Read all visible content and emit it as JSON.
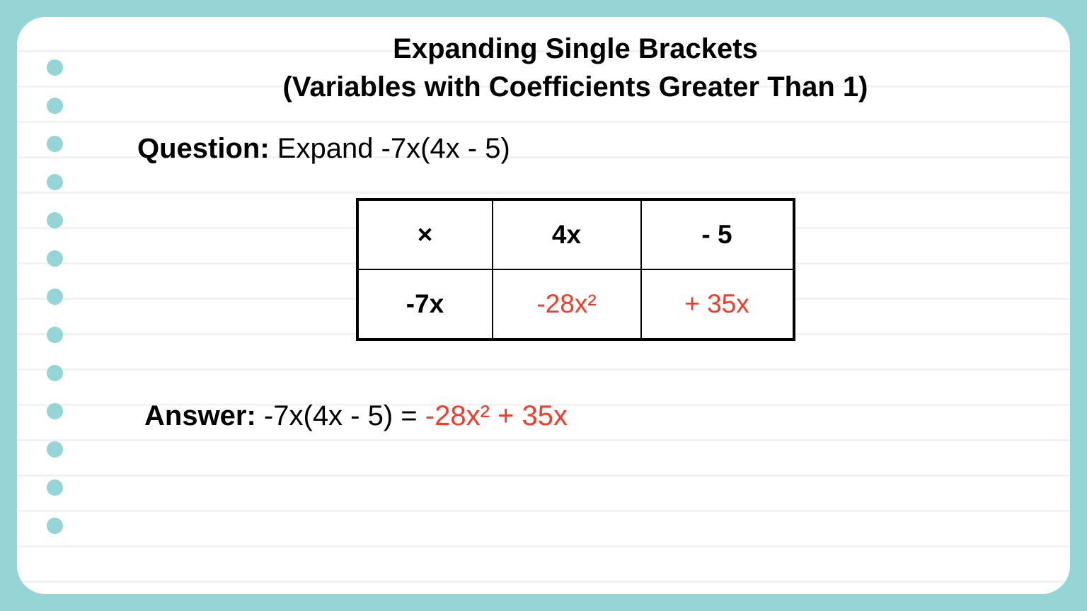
{
  "title_line1": "Expanding Single Brackets",
  "title_line2": "(Variables with Coefficients Greater Than 1)",
  "question": {
    "label": "Question:",
    "text": " Expand -7x(4x - 5)"
  },
  "table": {
    "r0c0": "×",
    "r0c1": "4x",
    "r0c2": "- 5",
    "r1c0": "-7x",
    "r1c1": "-28x²",
    "r1c2": "+ 35x"
  },
  "answer": {
    "label": "Answer:",
    "lhs": " -7x(4x - 5) = ",
    "rhs": "-28x² + 35x"
  },
  "colors": {
    "frame": "#95d5d5",
    "highlight": "#f83a29"
  }
}
